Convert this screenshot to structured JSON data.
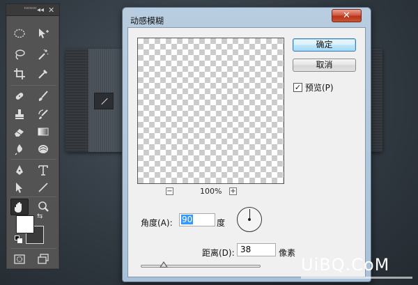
{
  "tools_panel": {
    "collapse": "◂◂",
    "close": "✕",
    "tools": [
      "marquee-tool",
      "move-tool",
      "lasso-tool",
      "magic-wand-tool",
      "crop-tool",
      "eyedropper-tool",
      "healing-brush-tool",
      "brush-tool",
      "clone-stamp-tool",
      "history-brush-tool",
      "eraser-tool",
      "gradient-tool",
      "blur-tool",
      "dodge-tool",
      "pen-tool",
      "type-tool",
      "path-selection-tool",
      "line-tool",
      "hand-tool",
      "zoom-tool",
      "quick-mask-tool",
      "screen-mode-tool"
    ],
    "active_tool": "hand-tool",
    "foreground_color": "#ffffff",
    "background_color": "#3b3b3b"
  },
  "dialog": {
    "title": "动感模糊",
    "close_label": "✕",
    "ok_label": "确定",
    "cancel_label": "取消",
    "preview_label": "预览(P)",
    "preview_checked": "✓",
    "zoom_out": "−",
    "zoom_in": "+",
    "zoom_level": "100%",
    "angle_label": "角度(A):",
    "angle_value": "90",
    "angle_unit": "度",
    "distance_label": "距离(D):",
    "distance_value": "38",
    "distance_unit": "像素",
    "distance_slider_fraction": 0.19
  },
  "watermark": "UiBQ.CoM"
}
